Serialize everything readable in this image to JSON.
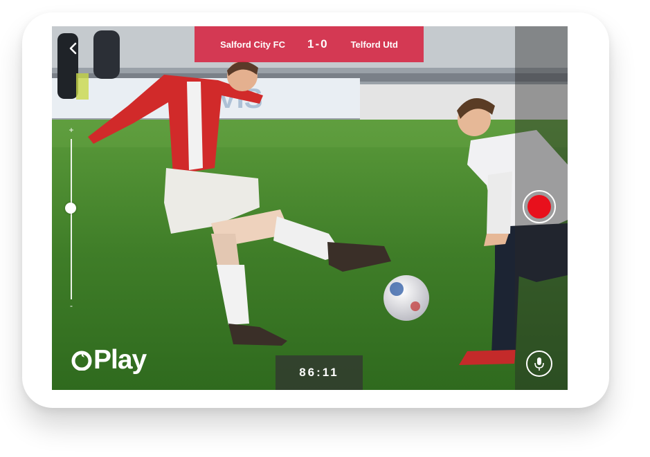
{
  "scoreboard": {
    "home_team": "Salford City FC",
    "score": "1-0",
    "away_team": "Telford Utd"
  },
  "timer": "86:11",
  "zoom": {
    "plus": "+",
    "minus": "-",
    "level": 0.57
  },
  "logo": {
    "text": "Play"
  },
  "colors": {
    "scoreboard": "#d62442",
    "record": "#e8101c",
    "pitch": "#3f7d28"
  },
  "icons": {
    "back": "chevron-left-icon",
    "record": "record-icon",
    "mic": "microphone-icon"
  }
}
